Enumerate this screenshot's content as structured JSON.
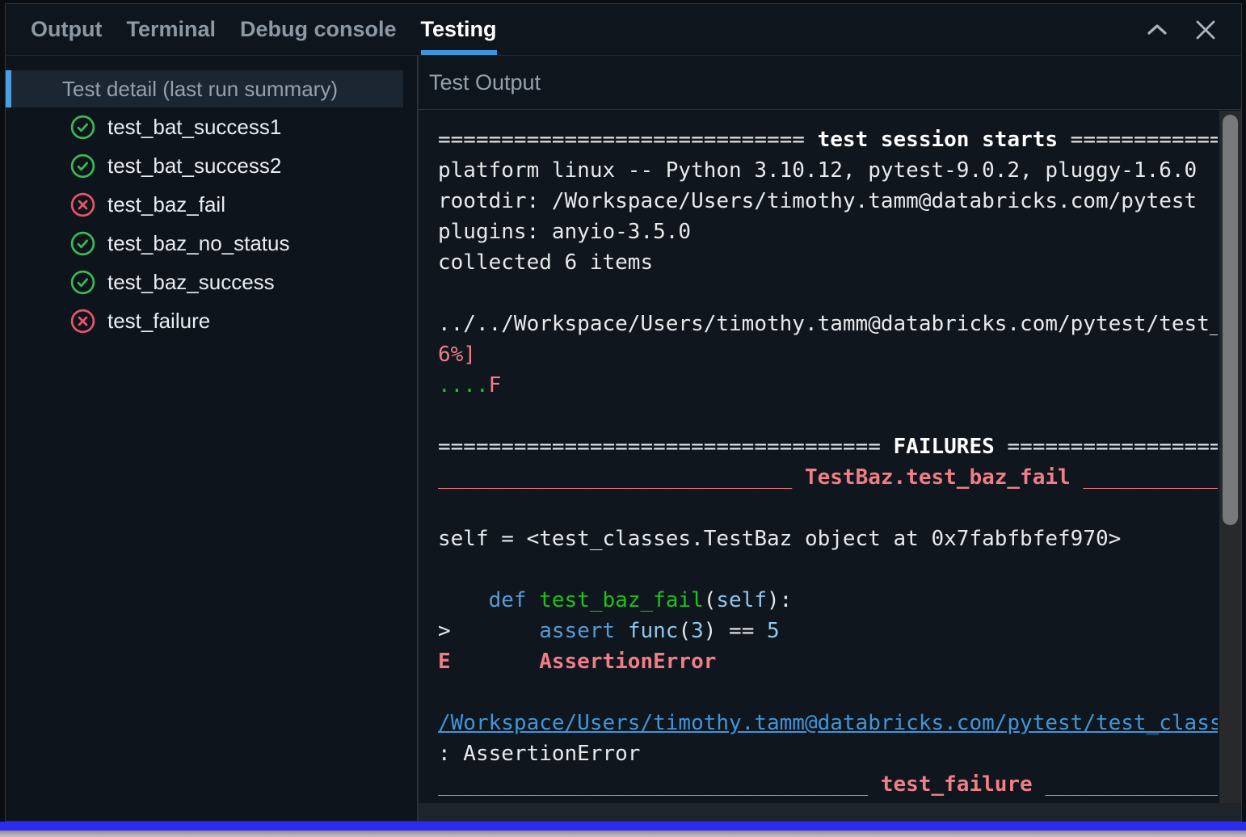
{
  "window": {
    "tabs": [
      {
        "label": "Output",
        "active": false
      },
      {
        "label": "Terminal",
        "active": false
      },
      {
        "label": "Debug console",
        "active": false
      },
      {
        "label": "Testing",
        "active": true
      }
    ],
    "controls": [
      {
        "icon": "chevron-up-icon"
      },
      {
        "icon": "close-icon"
      }
    ]
  },
  "sidebar": {
    "header": "Test detail (last run summary)",
    "items": [
      {
        "label": "test_bat_success1",
        "status": "pass",
        "icon": "check-circle-icon"
      },
      {
        "label": "test_bat_success2",
        "status": "pass",
        "icon": "check-circle-icon"
      },
      {
        "label": "test_baz_fail",
        "status": "fail",
        "icon": "x-circle-icon"
      },
      {
        "label": "test_baz_no_status",
        "status": "pass",
        "icon": "check-circle-icon"
      },
      {
        "label": "test_baz_success",
        "status": "pass",
        "icon": "check-circle-icon"
      },
      {
        "label": "test_failure",
        "status": "fail",
        "icon": "x-circle-icon"
      }
    ]
  },
  "output": {
    "title": "Test Output",
    "console_lines": [
      [
        [
          "w",
          "============================= "
        ],
        [
          "wb",
          "test session starts"
        ],
        [
          "w",
          " ===================="
        ]
      ],
      [
        [
          "w",
          "platform linux -- Python 3.10.12, pytest-9.0.2, pluggy-1.6.0"
        ]
      ],
      [
        [
          "w",
          "rootdir: /Workspace/Users/timothy.tamm@databricks.com/pytest"
        ]
      ],
      [
        [
          "w",
          "plugins: anyio-3.5.0"
        ]
      ],
      [
        [
          "w",
          "collected 6 items"
        ]
      ],
      [],
      [
        [
          "w",
          "../../Workspace/Users/timothy.tamm@databricks.com/pytest/test_"
        ]
      ],
      [
        [
          "salmon",
          "6%]"
        ]
      ],
      [
        [
          "green",
          "...."
        ],
        [
          "salmon",
          "F"
        ]
      ],
      [],
      [
        [
          "w",
          "=================================== "
        ],
        [
          "wb",
          "FAILURES"
        ],
        [
          "w",
          " ========================="
        ]
      ],
      [
        [
          "salmon",
          "____________________________ "
        ],
        [
          "salmonb",
          "TestBaz.test_baz_fail"
        ],
        [
          "salmon",
          " _______________"
        ]
      ],
      [],
      [
        [
          "w",
          "self = <test_classes.TestBaz object at 0x7fabfbfef970>"
        ]
      ],
      [],
      [
        [
          "w",
          "    "
        ],
        [
          "kw",
          "def"
        ],
        [
          "w",
          " "
        ],
        [
          "fn",
          "test_baz_fail"
        ],
        [
          "w",
          "("
        ],
        [
          "lit",
          "self"
        ],
        [
          "w",
          "):"
        ]
      ],
      [
        [
          "w",
          ">       "
        ],
        [
          "kw",
          "assert"
        ],
        [
          "w",
          " "
        ],
        [
          "lit",
          "func"
        ],
        [
          "w",
          "("
        ],
        [
          "lit",
          "3"
        ],
        [
          "w",
          ") == "
        ],
        [
          "lit",
          "5"
        ]
      ],
      [
        [
          "salmonb",
          "E       AssertionError"
        ]
      ],
      [],
      [
        [
          "link",
          "/Workspace/Users/timothy.tamm@databricks.com/pytest/test_class"
        ]
      ],
      [
        [
          "w",
          ": AssertionError"
        ]
      ],
      [
        [
          "salmon",
          "__________________________________ "
        ],
        [
          "salmonb",
          "test_failure"
        ],
        [
          "salmon",
          " ________________"
        ]
      ]
    ]
  },
  "colors": {
    "accent_blue": "#4393d9",
    "selection_bar_blue": "#4b9fe1",
    "success_green": "#3cb954",
    "fail_red": "#e8556a",
    "salmon": "#ef7e86",
    "bright_green": "#1bc31b",
    "keyword_blue": "#579bd5",
    "literal_blue": "#8ec8ed",
    "link_blue": "#3f96d8",
    "bottom_border_blue": "#2d2af0"
  }
}
